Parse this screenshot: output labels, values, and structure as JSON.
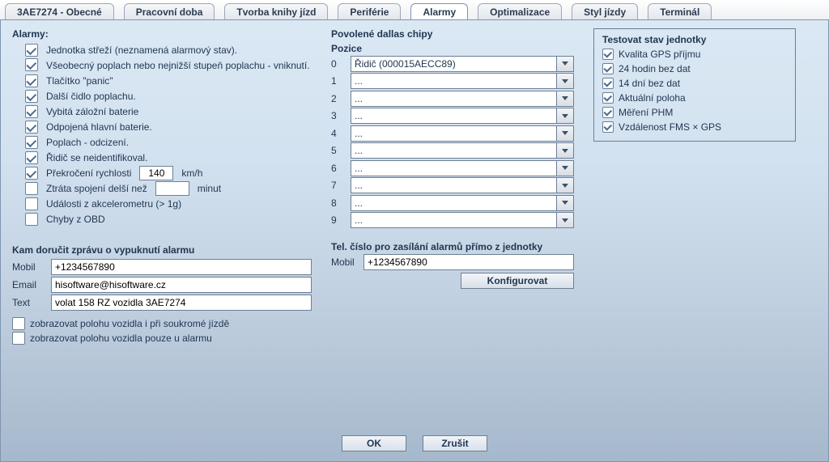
{
  "tabs": [
    "3AE7274 - Obecné",
    "Pracovní doba",
    "Tvorba knihy jízd",
    "Periférie",
    "Alarmy",
    "Optimalizace",
    "Styl jízdy",
    "Terminál"
  ],
  "active_tab_index": 4,
  "alarms_title": "Alarmy:",
  "alarms": [
    {
      "checked": true,
      "label": "Jednotka střeží (neznamená alarmový stav)."
    },
    {
      "checked": true,
      "label": "Všeobecný poplach nebo nejnižší stupeň poplachu - vniknutí."
    },
    {
      "checked": true,
      "label": "Tlačítko \"panic\""
    },
    {
      "checked": true,
      "label": "Další čidlo poplachu."
    },
    {
      "checked": true,
      "label": "Vybitá záložní baterie"
    },
    {
      "checked": true,
      "label": "Odpojená hlavní baterie."
    },
    {
      "checked": true,
      "label": "Poplach - odcizení."
    },
    {
      "checked": true,
      "label": "Řidič se neidentifikoval."
    }
  ],
  "alarm_speed": {
    "checked": true,
    "prefix": "Překročení rychlosti",
    "value": "140",
    "suffix": "km/h"
  },
  "alarm_conn": {
    "checked": false,
    "prefix": "Ztráta spojení delší než",
    "value": "",
    "suffix": "minut"
  },
  "alarm_accel": {
    "checked": false,
    "label": "Události z akcelerometru (> 1g)"
  },
  "alarm_obd": {
    "checked": false,
    "label": "Chyby z OBD"
  },
  "delivery_title": "Kam doručit zprávu o vypuknutí alarmu",
  "delivery": {
    "mobil_label": "Mobil",
    "mobil_value": "+1234567890",
    "email_label": "Email",
    "email_value": "hisoftware@hisoftware.cz",
    "text_label": "Text",
    "text_value": "volat 158 RZ vozidla 3AE7274"
  },
  "opt_private": {
    "checked": false,
    "label": "zobrazovat polohu vozidla i při soukromé jízdě"
  },
  "opt_alarm": {
    "checked": false,
    "label": "zobrazovat polohu vozidla pouze u alarmu"
  },
  "dallas_title": "Povolené dallas chipy",
  "dallas_pos_header": "Pozice",
  "dallas": [
    {
      "idx": "0",
      "value": "Řidič (000015AECC89)"
    },
    {
      "idx": "1",
      "value": "..."
    },
    {
      "idx": "2",
      "value": "..."
    },
    {
      "idx": "3",
      "value": "..."
    },
    {
      "idx": "4",
      "value": "..."
    },
    {
      "idx": "5",
      "value": "..."
    },
    {
      "idx": "6",
      "value": "..."
    },
    {
      "idx": "7",
      "value": "..."
    },
    {
      "idx": "8",
      "value": "..."
    },
    {
      "idx": "9",
      "value": "..."
    }
  ],
  "tel_title": "Tel. číslo pro zasílání alarmů přímo z jednotky",
  "tel_label": "Mobil",
  "tel_value": "+1234567890",
  "configure_label": "Konfigurovat",
  "test_title": "Testovat stav jednotky",
  "tests": [
    {
      "checked": true,
      "label": "Kvalita GPS příjmu"
    },
    {
      "checked": true,
      "label": "24 hodin bez dat"
    },
    {
      "checked": true,
      "label": "14 dní bez dat"
    },
    {
      "checked": true,
      "label": "Aktuální poloha"
    },
    {
      "checked": true,
      "label": "Měření PHM"
    },
    {
      "checked": true,
      "label": "Vzdálenost FMS × GPS"
    }
  ],
  "ok_label": "OK",
  "cancel_label": "Zrušit"
}
